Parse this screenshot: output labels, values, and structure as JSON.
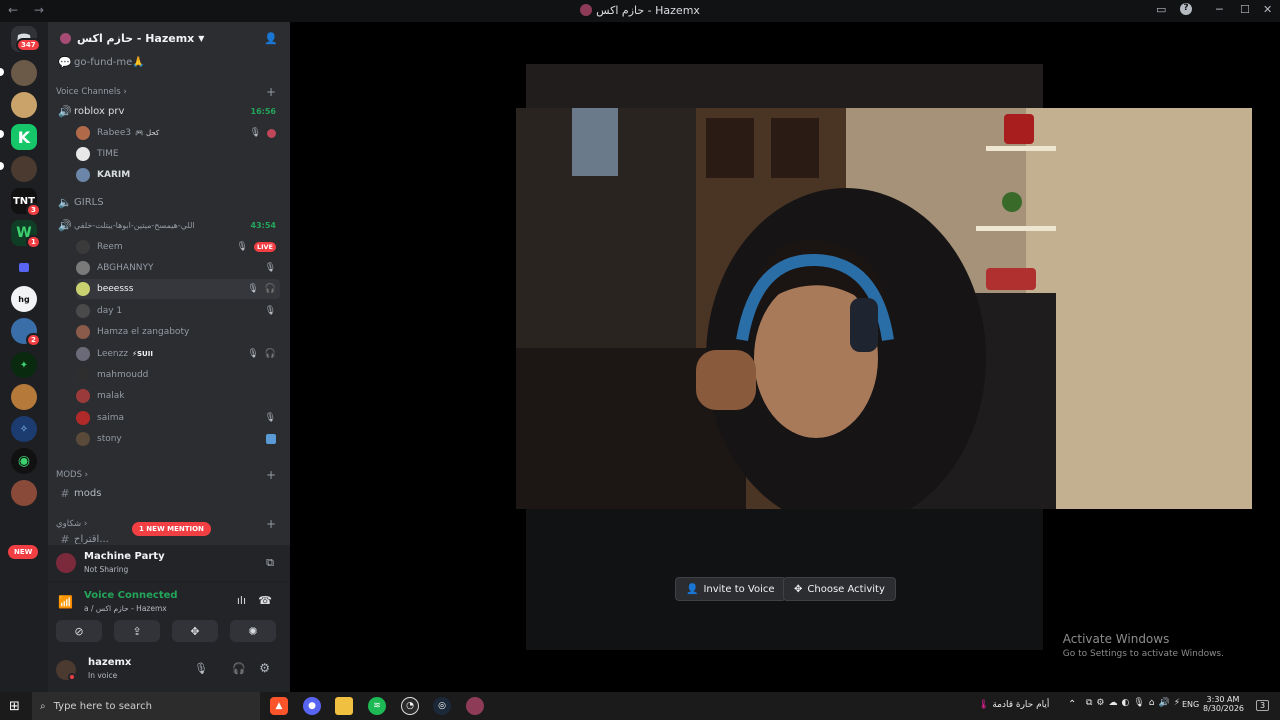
{
  "window": {
    "title": "حازم اكس - Hazemx",
    "back": "←",
    "forward": "→"
  },
  "rail": {
    "home_badge": "347",
    "badges": {
      "tnt": "3",
      "w": "1",
      "p2": "2"
    },
    "tnt_label": "TNT",
    "new_label": "NEW"
  },
  "guild": {
    "name": "حازم اكس - Hazemx",
    "channels": {
      "gofund": "go-fund-me🙏",
      "voice_category": "Voice Channels",
      "roblox": "roblox prv",
      "roblox_timer": "16:56",
      "girls": "GIRLS",
      "arabic_channel": "اللي-هيمسح-ميتين-ابوها-يبتلت-خلفي",
      "arabic_timer": "43:54",
      "mods_category": "MODS",
      "mods": "mods",
      "sha_category": "شكاوي",
      "partial": "اقتراح..."
    },
    "roblox_users": [
      {
        "name": "Rabee3",
        "tag": "🎮 كحل"
      },
      {
        "name": "TIME",
        "tag": ""
      },
      {
        "name": "KARIM",
        "tag": ""
      }
    ],
    "arabic_users": [
      {
        "name": "Reem",
        "live": "LIVE"
      },
      {
        "name": "ABGHANNYY"
      },
      {
        "name": "beeesss"
      },
      {
        "name": "day 1"
      },
      {
        "name": "Hamza el zangaboty"
      },
      {
        "name": "Leenzz",
        "tag": "⚡SUII"
      },
      {
        "name": "mahmoudd"
      },
      {
        "name": "malak"
      },
      {
        "name": "saima"
      },
      {
        "name": "stony"
      }
    ],
    "mention_pill": "1 NEW MENTION"
  },
  "activity": {
    "title": "Machine Party",
    "subtitle": "Not Sharing"
  },
  "voice": {
    "status": "Voice Connected",
    "location": "a / حازم اكس - Hazemx"
  },
  "user": {
    "name": "hazemx",
    "status": "In voice"
  },
  "stage": {
    "invite": "Invite to Voice",
    "choose": "Choose Activity",
    "watermark_title": "Activate Windows",
    "watermark_sub": "Go to Settings to activate Windows."
  },
  "taskbar": {
    "search_placeholder": "Type here to search",
    "weather": "أيام حارة قادمة",
    "lang": "ENG",
    "time": "3:30 AM",
    "date": "8/30/2026",
    "notif": "3"
  },
  "colors": {
    "accent": "#5865f2",
    "online": "#23a55a",
    "danger": "#f23f43"
  }
}
